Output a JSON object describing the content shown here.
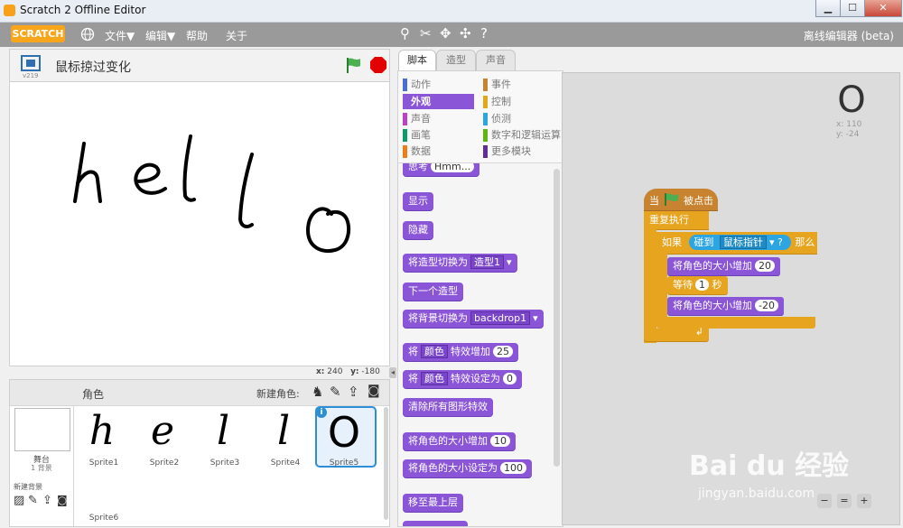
{
  "window": {
    "title": "Scratch 2 Offline Editor",
    "minimize": "▁",
    "maximize": "☐",
    "close": "✕"
  },
  "menubar": {
    "logo": "SCRATCH",
    "globe_icon": "globe-icon",
    "items": [
      "文件▼",
      "编辑▼",
      "帮助",
      "关于"
    ],
    "offline_label": "离线编辑器 (beta)"
  },
  "stage": {
    "version": "v219",
    "title": "鼠标掠过变化",
    "letters": [
      "h",
      "e",
      "l",
      "l",
      "o"
    ],
    "x_label": "x:",
    "x_value": "240",
    "y_label": "y:",
    "y_value": "-180"
  },
  "sprites": {
    "header": "角色",
    "new_sprite_label": "新建角色:",
    "stage_label": "舞台",
    "stage_count": "1 背景",
    "new_backdrop_label": "新建背景",
    "items": [
      {
        "glyph": "h",
        "name": "Sprite1"
      },
      {
        "glyph": "e",
        "name": "Sprite2"
      },
      {
        "glyph": "l",
        "name": "Sprite3"
      },
      {
        "glyph": "l",
        "name": "Sprite4"
      },
      {
        "glyph": "O",
        "name": "Sprite5"
      }
    ],
    "extra": "Sprite6"
  },
  "tabs": [
    "脚本",
    "造型",
    "声音"
  ],
  "categories": {
    "left": [
      {
        "label": "动作",
        "color": "#4a6cd4"
      },
      {
        "label": "外观",
        "color": "#8a55d7"
      },
      {
        "label": "声音",
        "color": "#bb42c3"
      },
      {
        "label": "画笔",
        "color": "#0e9a6c"
      },
      {
        "label": "数据",
        "color": "#ee7d16"
      }
    ],
    "right": [
      {
        "label": "事件",
        "color": "#c88330"
      },
      {
        "label": "控制",
        "color": "#e1a91a"
      },
      {
        "label": "侦测",
        "color": "#2ca5e2"
      },
      {
        "label": "数字和逻辑运算",
        "color": "#5cb712"
      },
      {
        "label": "更多模块",
        "color": "#632d99"
      }
    ]
  },
  "palette": {
    "think": "思考",
    "think_value": "Hmm...",
    "show": "显示",
    "hide": "隐藏",
    "switch_costume": "将造型切换为",
    "costume_value": "造型1",
    "next_costume": "下一个造型",
    "switch_backdrop": "将背景切换为",
    "backdrop_value": "backdrop1",
    "change_effect_a": "将",
    "effect_value": "颜色",
    "change_effect_b": "特效增加",
    "change_effect_value": "25",
    "set_effect_a": "将",
    "set_effect_b": "特效设定为",
    "set_effect_value": "0",
    "clear_effects": "清除所有图形特效",
    "change_size": "将角色的大小增加",
    "change_size_value": "10",
    "set_size": "将角色的大小设定为",
    "set_size_value": "100",
    "front": "移至最上层"
  },
  "script": {
    "hat_when": "当",
    "hat_clicked": "被点击",
    "forever": "重复执行",
    "if": "如果",
    "touching": "碰到",
    "touching_value": "鼠标指针",
    "question": "?",
    "then": "那么",
    "change_size": "将角色的大小增加",
    "change_size_value": "20",
    "wait": "等待",
    "wait_value": "1",
    "wait_unit": "秒",
    "change_size2": "将角色的大小增加",
    "change_size2_value": "-20",
    "sprite_x_label": "x:",
    "sprite_x": "110",
    "sprite_y_label": "y:",
    "sprite_y": "-24"
  },
  "watermark": {
    "brand": "Bai du 经验",
    "url": "jingyan.baidu.com"
  }
}
